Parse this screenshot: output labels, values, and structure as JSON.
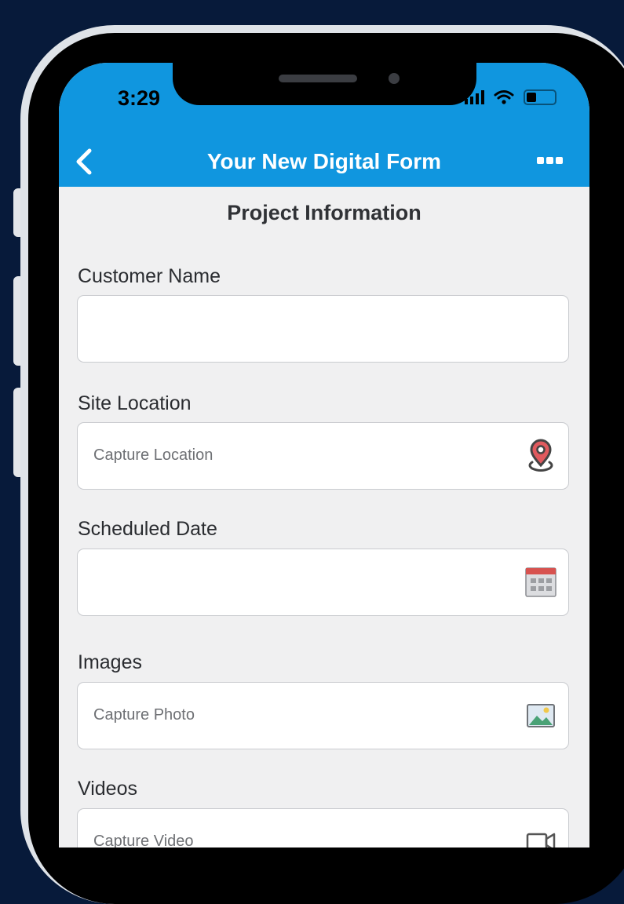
{
  "status_bar": {
    "time": "3:29"
  },
  "nav": {
    "title": "Your New Digital Form",
    "back_icon": "chevron-left-icon",
    "menu_icon": "more-horizontal-icon"
  },
  "form": {
    "section_title": "Project Information",
    "fields": [
      {
        "label": "Customer Name",
        "placeholder": "",
        "icon": ""
      },
      {
        "label": "Site Location",
        "placeholder": "Capture Location",
        "icon": "location-pin-icon"
      },
      {
        "label": "Scheduled Date",
        "placeholder": "",
        "icon": "calendar-icon"
      },
      {
        "label": "Images",
        "placeholder": "Capture Photo",
        "icon": "image-icon"
      },
      {
        "label": "Videos",
        "placeholder": "Capture Video",
        "icon": "video-camera-icon"
      }
    ]
  },
  "colors": {
    "background": "#071a3a",
    "header_blue": "#1096df",
    "screen_bg": "#f0f0f1",
    "pin_red": "#e05a5e"
  }
}
